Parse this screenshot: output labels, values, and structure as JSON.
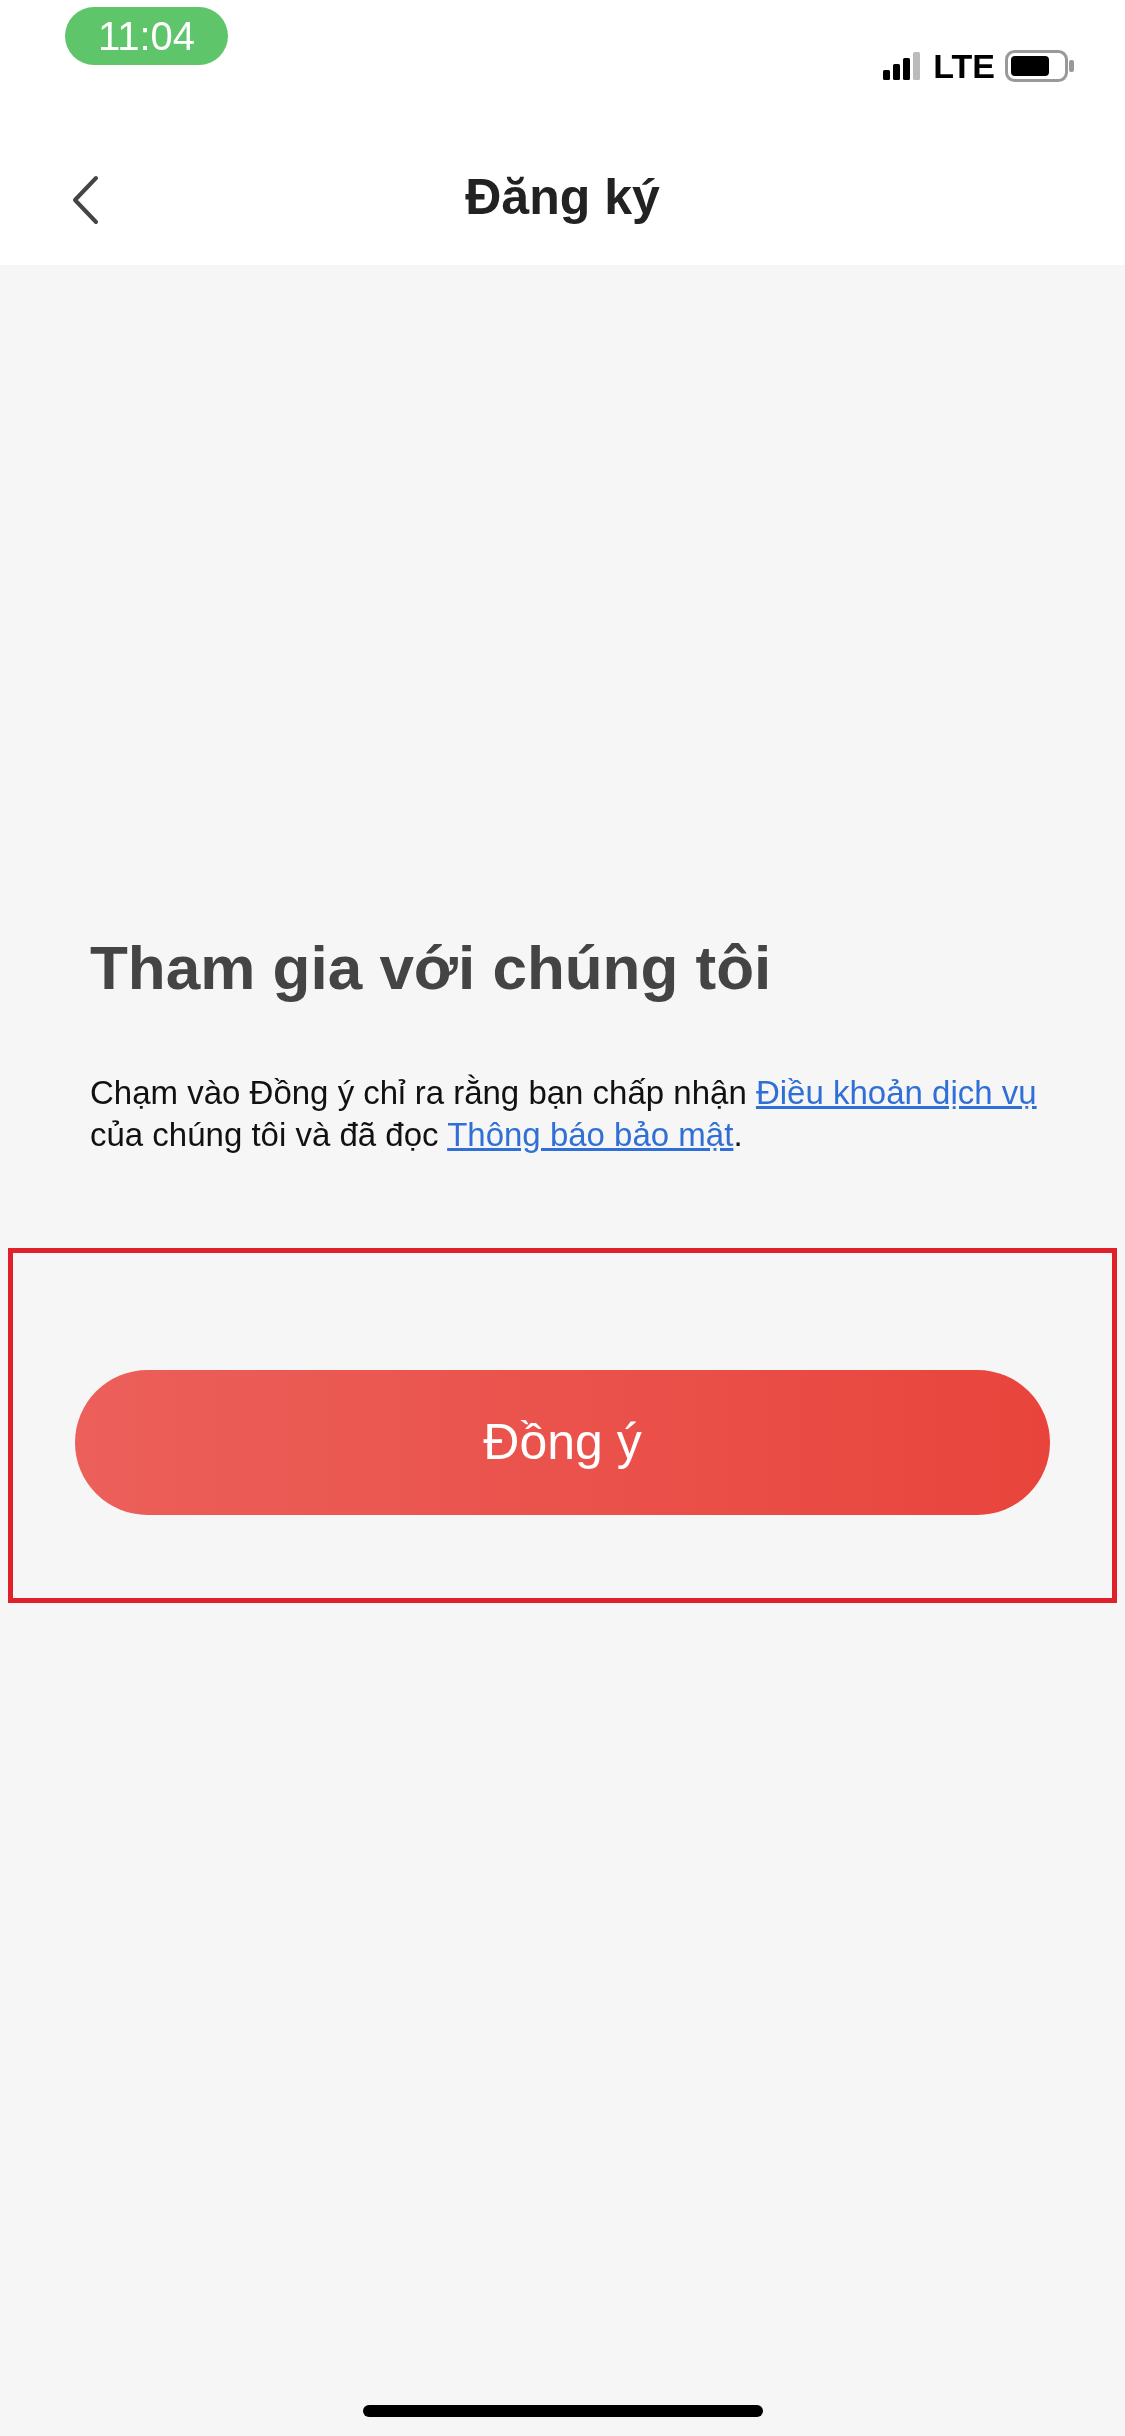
{
  "status_bar": {
    "time": "11:04",
    "network": "LTE"
  },
  "nav": {
    "title": "Đăng ký"
  },
  "heading": "Tham gia với chúng tôi",
  "consent": [
    {
      "kind": "text",
      "text": "Chạm vào Đồng ý chỉ ra rằng bạn chấp nhận "
    },
    {
      "kind": "link",
      "text": "Điều khoản dịch vụ"
    },
    {
      "kind": "text",
      "text": " của chúng tôi và đã đọc "
    },
    {
      "kind": "link",
      "text": "Thông báo bảo mật"
    },
    {
      "kind": "text",
      "text": "."
    }
  ],
  "highlight": true,
  "agree_button": "Đồng ý"
}
